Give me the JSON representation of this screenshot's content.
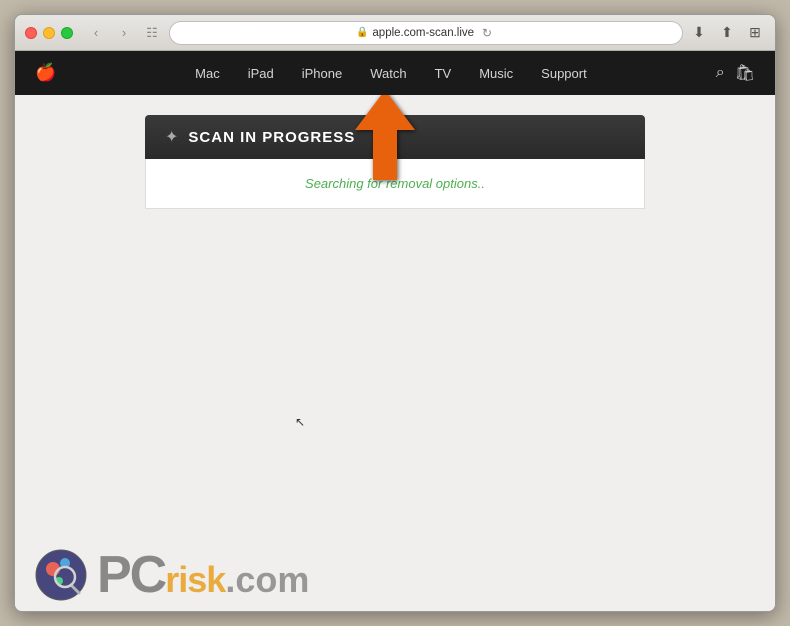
{
  "browser": {
    "url": "apple.com-scan.live",
    "tab_title": "apple.com-scan.live"
  },
  "apple_nav": {
    "logo": "🍎",
    "items": [
      {
        "label": "Mac"
      },
      {
        "label": "iPad"
      },
      {
        "label": "iPhone"
      },
      {
        "label": "Watch"
      },
      {
        "label": "TV"
      },
      {
        "label": "Music"
      },
      {
        "label": "Support"
      }
    ]
  },
  "scan": {
    "title": "SCAN IN PROGRESS",
    "status": "Searching for removal options.."
  },
  "watermark": {
    "brand": "PC",
    "suffix": "risk.com"
  },
  "arrow": {
    "color": "#e8620a"
  }
}
